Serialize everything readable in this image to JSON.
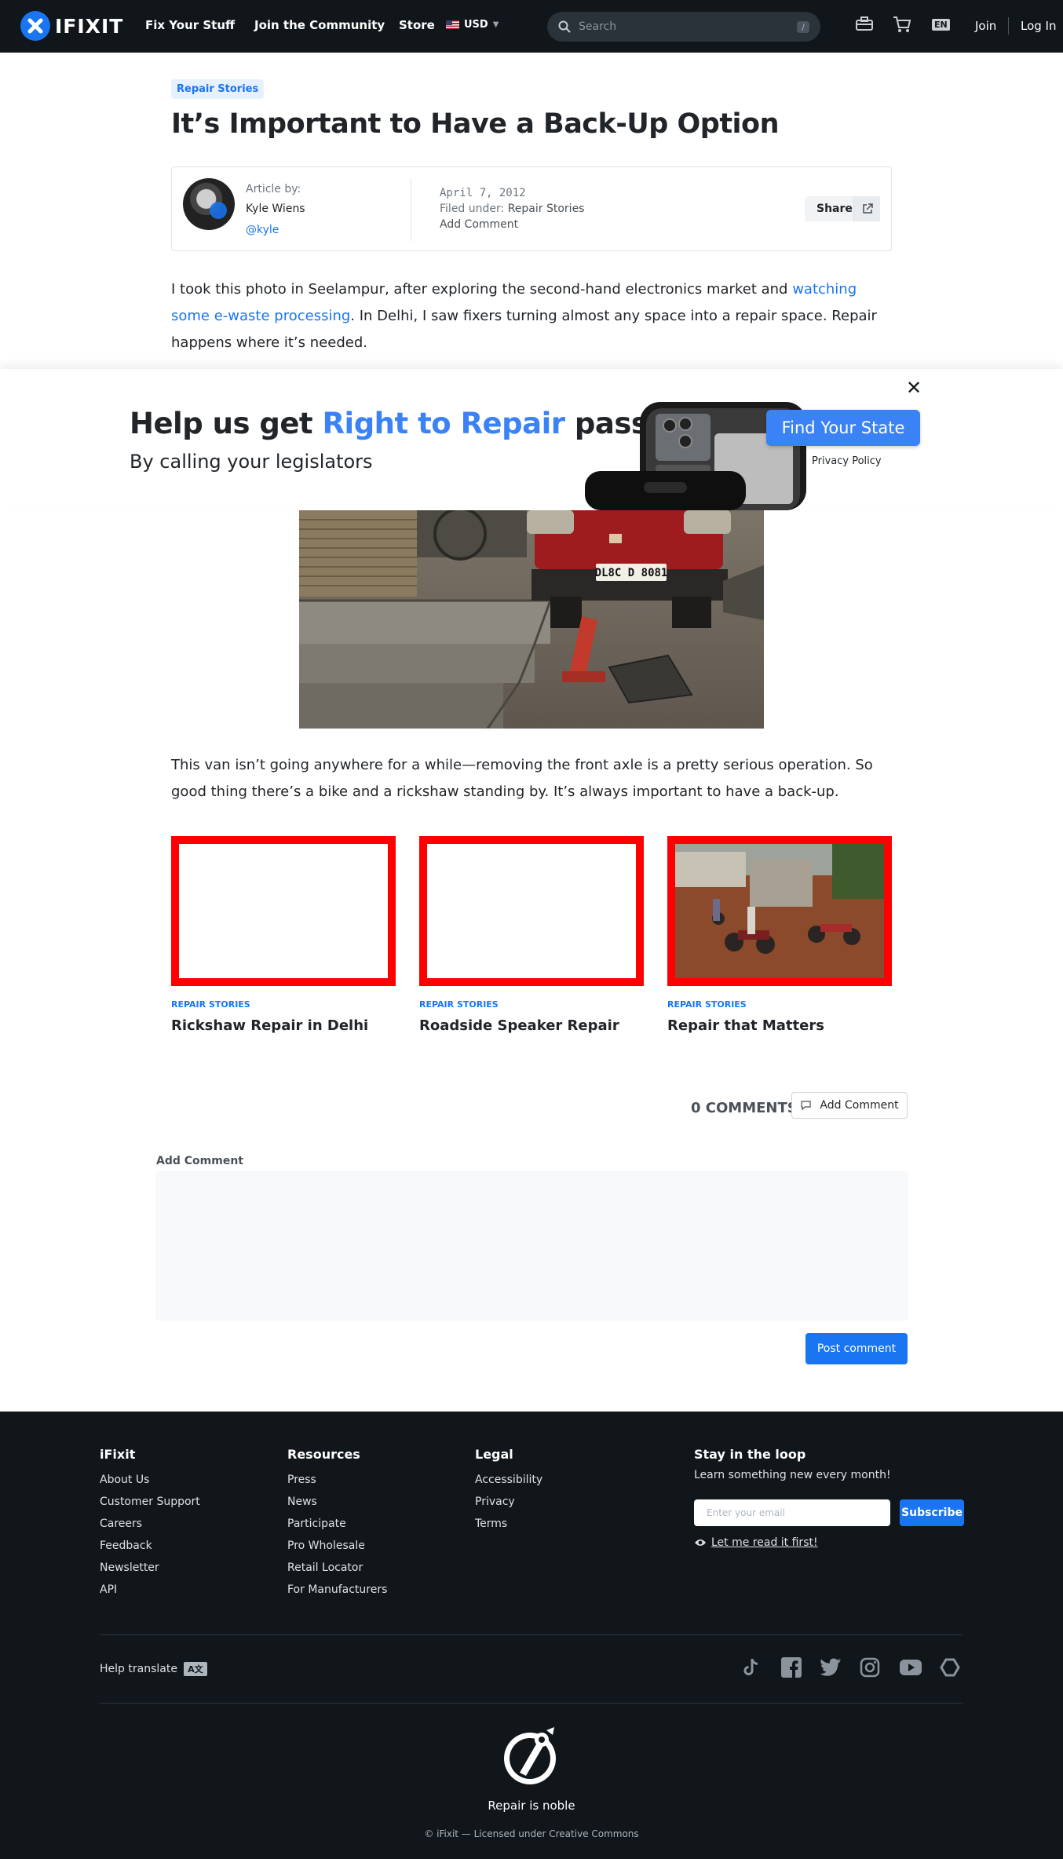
{
  "nav": {
    "brand": "IFIXIT",
    "links": [
      "Fix Your Stuff",
      "Join the Community",
      "Store"
    ],
    "currency": "USD",
    "search_placeholder": "Search",
    "search_shortcut": "/",
    "language": "EN",
    "join": "Join",
    "login": "Log In"
  },
  "article": {
    "tag": "Repair Stories",
    "title": "It’s Important to Have a Back-Up Option",
    "author_label": "Article by:",
    "author_name": "Kyle Wiens",
    "author_handle": "@kyle",
    "date": "April 7, 2012",
    "filed_label": "Filed under:",
    "filed_value": "Repair Stories",
    "add_comment": "Add Comment",
    "share": "Share",
    "para1_a": "I took this photo in Seelampur, after exploring the second-hand electronics market and ",
    "para1_link": "watching some e-waste processing",
    "para1_b": ". In Delhi, I saw fixers turning almost any space into a repair space. Repair happens where it’s needed.",
    "plate": "DL8C D 8081",
    "para2": "This van isn’t going anywhere for a while—removing the front axle is a pretty serious operation. So good thing there’s a bike and a rickshaw standing by. It’s always important to have a back-up."
  },
  "banner": {
    "heading_a": "Help us get ",
    "heading_highlight": "Right to Repair",
    "heading_b": " passed",
    "subheading": "By calling your legislators",
    "cta": "Find Your State",
    "privacy": "Privacy Policy",
    "close": "✕"
  },
  "related": [
    {
      "category": "Repair Stories",
      "title": "Rickshaw Repair in Delhi"
    },
    {
      "category": "Repair Stories",
      "title": "Roadside Speaker Repair"
    },
    {
      "category": "Repair Stories",
      "title": "Repair that Matters"
    }
  ],
  "comments": {
    "count_label": "0 COMMENTS",
    "add_button": "Add Comment",
    "form_label": "Add Comment",
    "post_button": "Post comment"
  },
  "footer": {
    "columns": [
      {
        "heading": "iFixit",
        "items": [
          "About Us",
          "Customer Support",
          "Careers",
          "Feedback",
          "Newsletter",
          "API"
        ]
      },
      {
        "heading": "Resources",
        "items": [
          "Press",
          "News",
          "Participate",
          "Pro Wholesale",
          "Retail Locator",
          "For Manufacturers"
        ]
      },
      {
        "heading": "Legal",
        "items": [
          "Accessibility",
          "Privacy",
          "Terms"
        ]
      }
    ],
    "loop_heading": "Stay in the loop",
    "loop_sub": "Learn something new every month!",
    "email_placeholder": "Enter your email",
    "subscribe": "Subscribe",
    "read_first": "Let me read it first!",
    "help_translate": "Help translate",
    "social_icons": [
      "tiktok-icon",
      "facebook-icon",
      "twitter-icon",
      "instagram-icon",
      "youtube-icon",
      "hexagon-icon"
    ],
    "tagline": "Repair is noble",
    "copyright": "© iFixit — Licensed under Creative Commons"
  },
  "colors": {
    "nav_bg": "#11161a",
    "accent": "#1975f1",
    "banner_accent": "#3b82f6",
    "card_border": "#ff0000"
  }
}
